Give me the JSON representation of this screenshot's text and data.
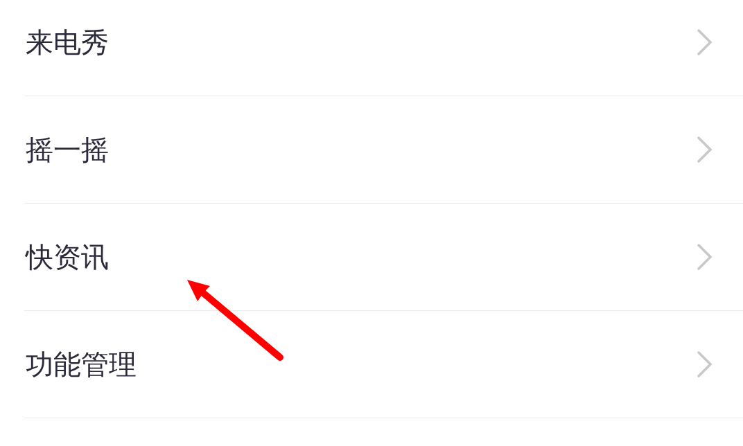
{
  "items": [
    {
      "label": "来电秀"
    },
    {
      "label": "摇一摇"
    },
    {
      "label": "快资讯"
    },
    {
      "label": "功能管理"
    }
  ]
}
